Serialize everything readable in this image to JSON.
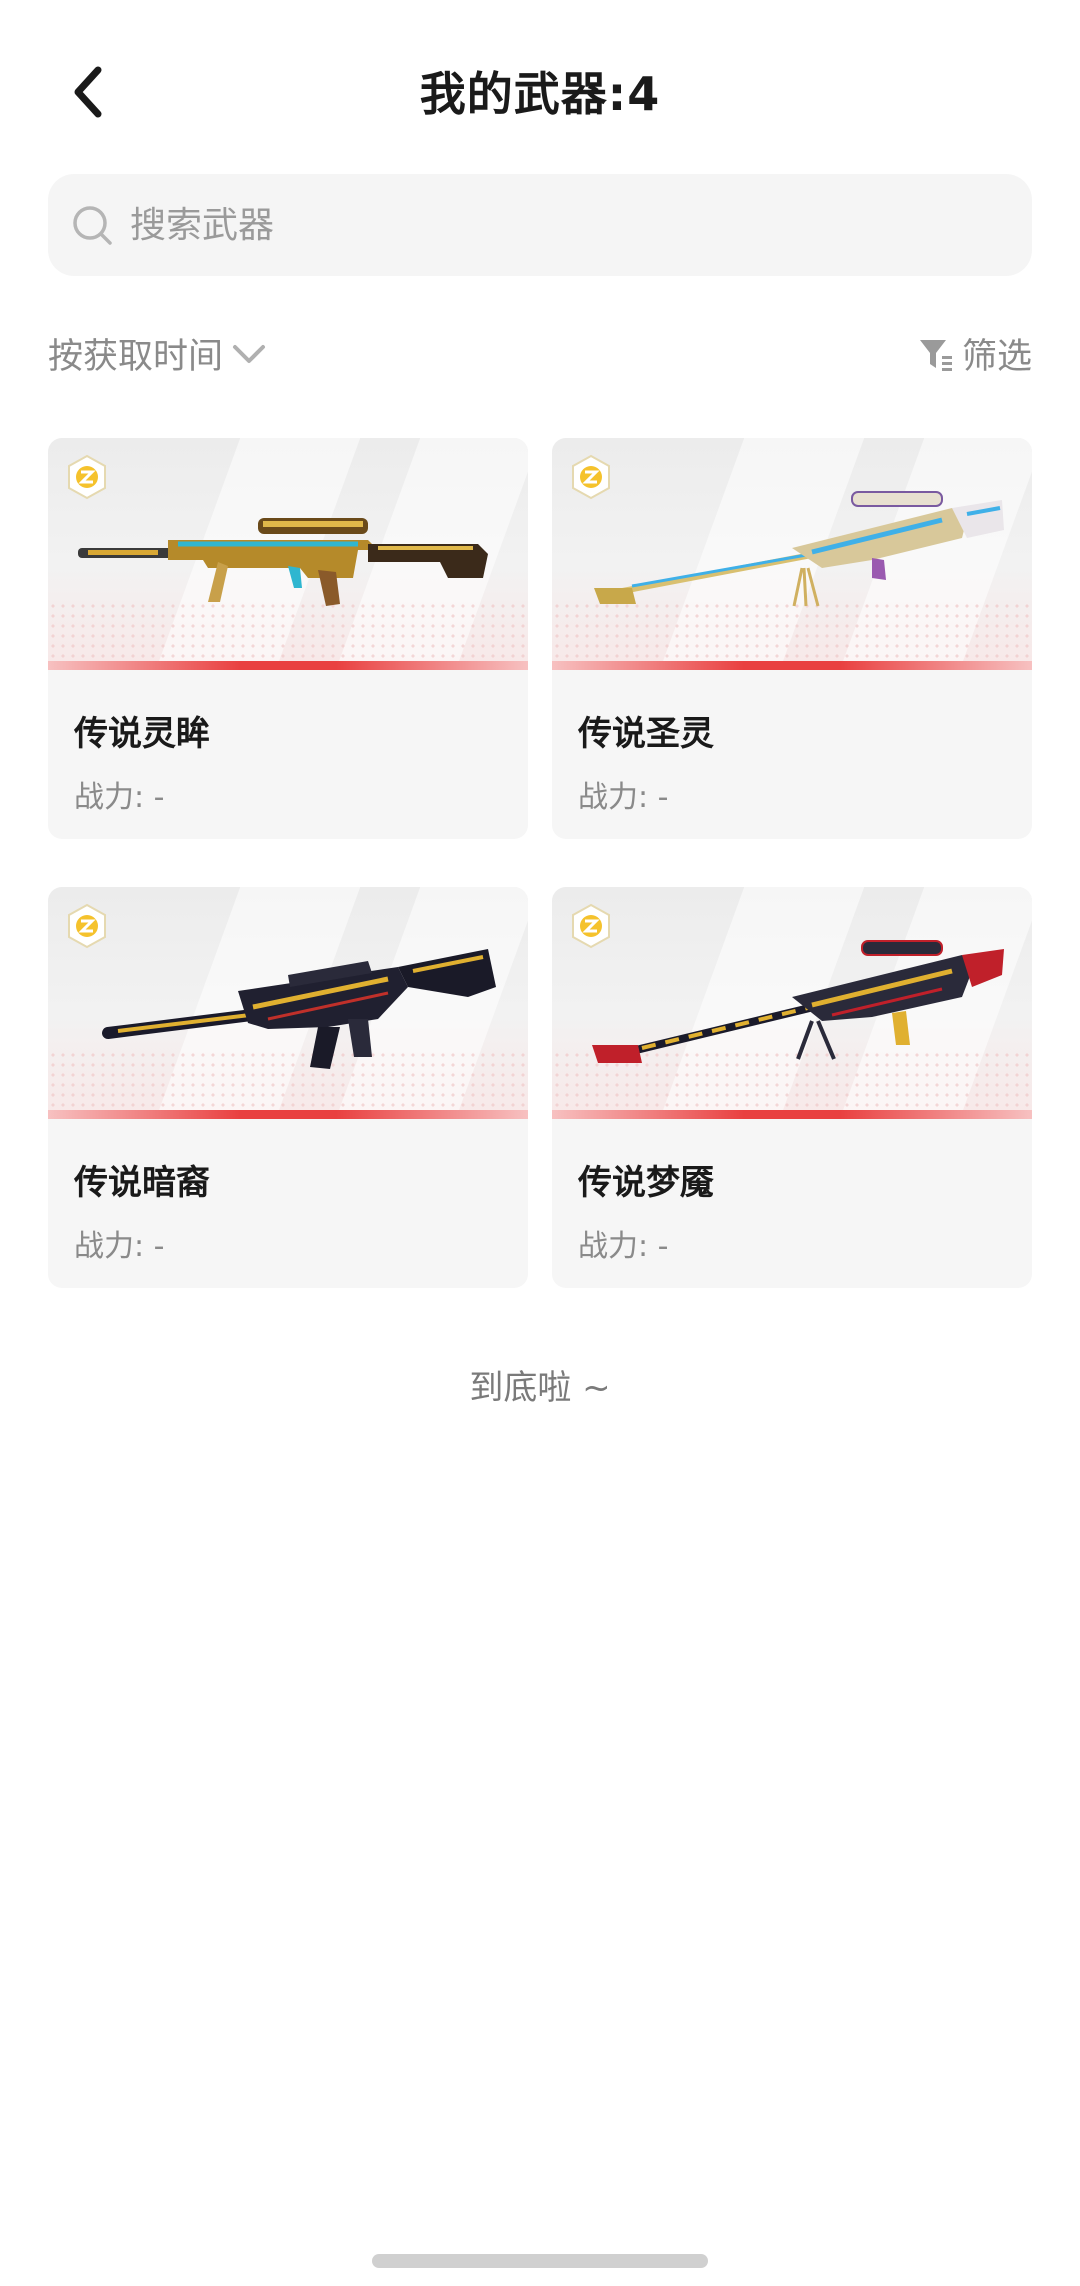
{
  "header": {
    "title": "我的武器:4"
  },
  "search": {
    "placeholder": "搜索武器"
  },
  "sortbar": {
    "sort_label": "按获取时间",
    "filter_label": "筛选"
  },
  "weapons": [
    {
      "name": "传说灵眸",
      "power": "战力: -",
      "icon": "gold-sniper-rifle-icon"
    },
    {
      "name": "传说圣灵",
      "power": "战力: -",
      "icon": "blue-gold-sniper-rifle-icon"
    },
    {
      "name": "传说暗裔",
      "power": "战力: -",
      "icon": "dark-gold-assault-rifle-icon"
    },
    {
      "name": "传说梦魇",
      "power": "战力: -",
      "icon": "red-gold-sniper-rifle-icon"
    }
  ],
  "footer": {
    "end_text": "到底啦 ~"
  },
  "colors": {
    "accent": "#e94040",
    "badge": "#f5c22c",
    "text_secondary": "#8a8a8a"
  }
}
